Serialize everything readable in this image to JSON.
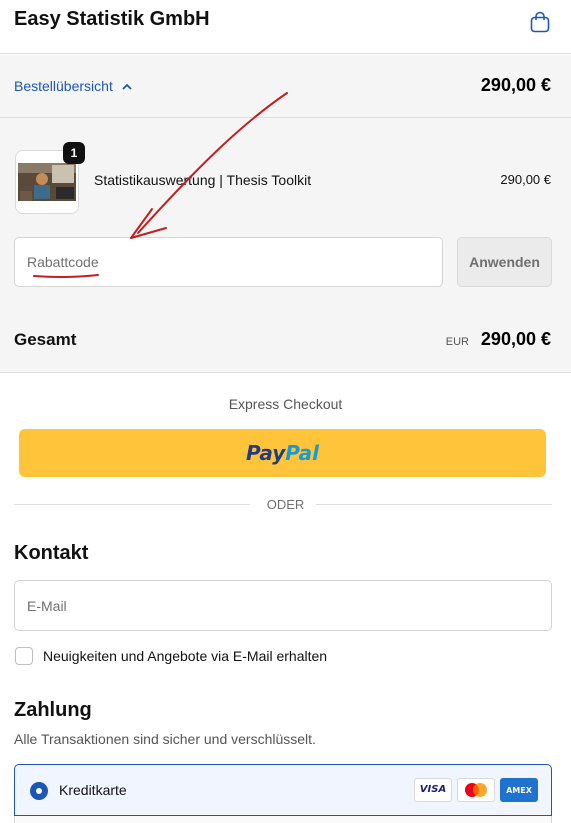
{
  "header": {
    "brand": "Easy Statistik GmbH",
    "cart_icon": "shopping-bag-icon"
  },
  "summary": {
    "toggle_label": "Bestellübersicht",
    "toggle_total": "290,00 €",
    "product": {
      "quantity": "1",
      "name": "Statistikauswertung | Thesis Toolkit",
      "price": "290,00 €"
    },
    "discount_placeholder": "Rabattcode",
    "apply_label": "Anwenden",
    "total_label": "Gesamt",
    "total_currency": "EUR",
    "total_amount": "290,00 €"
  },
  "express": {
    "title": "Express Checkout",
    "paypal_part1": "Pay",
    "paypal_part2": "Pal",
    "divider": "ODER"
  },
  "contact": {
    "title": "Kontakt",
    "email_placeholder": "E-Mail",
    "newsletter_label": "Neuigkeiten und Angebote via E-Mail erhalten"
  },
  "payment": {
    "title": "Zahlung",
    "subtitle": "Alle Transaktionen sind sicher und verschlüsselt.",
    "method_label": "Kreditkarte",
    "cards": [
      "VISA",
      "Mastercard",
      "AMEX"
    ],
    "visa": "VISA",
    "amex": "AMEX"
  },
  "colors": {
    "accent": "#1a57b8",
    "paypal_yellow": "#ffc439",
    "annotation_red": "#c21f1f"
  }
}
